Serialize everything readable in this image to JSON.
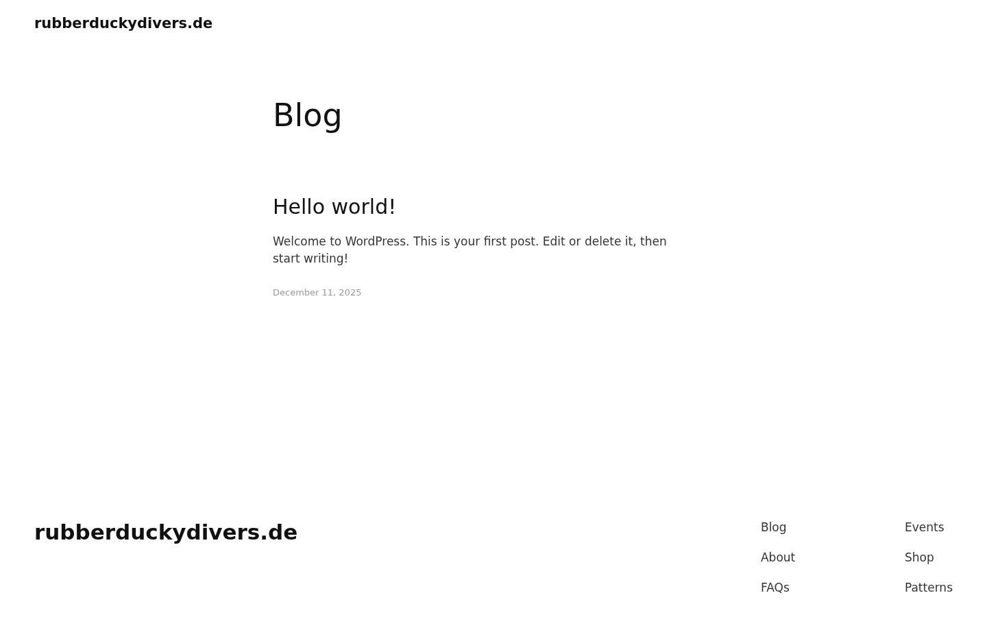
{
  "header": {
    "site_title": "rubberduckydivers.de"
  },
  "page_title": "Blog",
  "posts": [
    {
      "title": "Hello world!",
      "excerpt": "Welcome to WordPress. This is your first post. Edit or delete it, then start writing!",
      "date": "December 11, 2025"
    }
  ],
  "footer": {
    "site_title": "rubberduckydivers.de",
    "nav_columns": [
      [
        "Blog",
        "About",
        "FAQs"
      ],
      [
        "Events",
        "Shop",
        "Patterns"
      ]
    ]
  }
}
